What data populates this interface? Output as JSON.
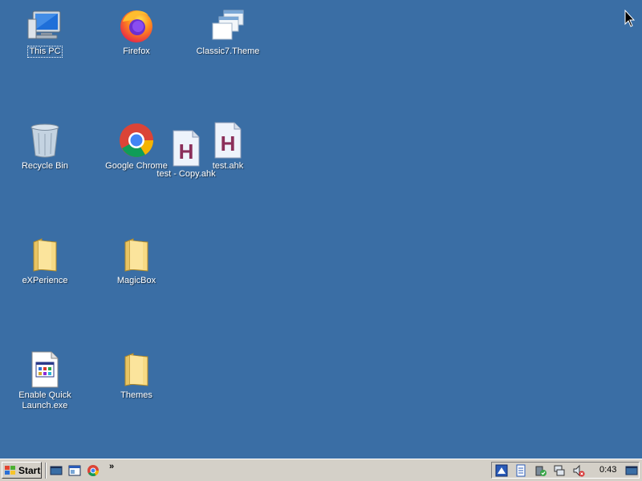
{
  "desktop": {
    "background": "#3a6ea5",
    "icons": [
      {
        "label": "This PC",
        "icon": "computer-icon"
      },
      {
        "label": "Firefox",
        "icon": "firefox-icon"
      },
      {
        "label": "Classic7.Theme",
        "icon": "theme-file-icon"
      },
      {
        "label": "Recycle Bin",
        "icon": "recycle-bin-icon"
      },
      {
        "label": "Google Chrome",
        "icon": "chrome-icon"
      },
      {
        "label": "test.ahk",
        "icon": "ahk-script-icon"
      },
      {
        "label": "test - Copy.ahk",
        "icon": "ahk-script-icon"
      },
      {
        "label": "eXPerience",
        "icon": "folder-icon"
      },
      {
        "label": "MagicBox",
        "icon": "folder-icon"
      },
      {
        "label": "Enable Quick\nLaunch.exe",
        "icon": "exe-icon"
      },
      {
        "label": "Themes",
        "icon": "folder-icon"
      }
    ]
  },
  "taskbar": {
    "start_label": "Start",
    "quick_launch": [
      "show-desktop-icon",
      "explorer-icon",
      "chrome-icon"
    ],
    "overflow": "»",
    "tray_icons": [
      "media-icon",
      "document-icon",
      "power-icon",
      "network-icon",
      "volume-muted-icon"
    ],
    "clock": "0:43",
    "show_desktop": "show-desktop-icon"
  }
}
